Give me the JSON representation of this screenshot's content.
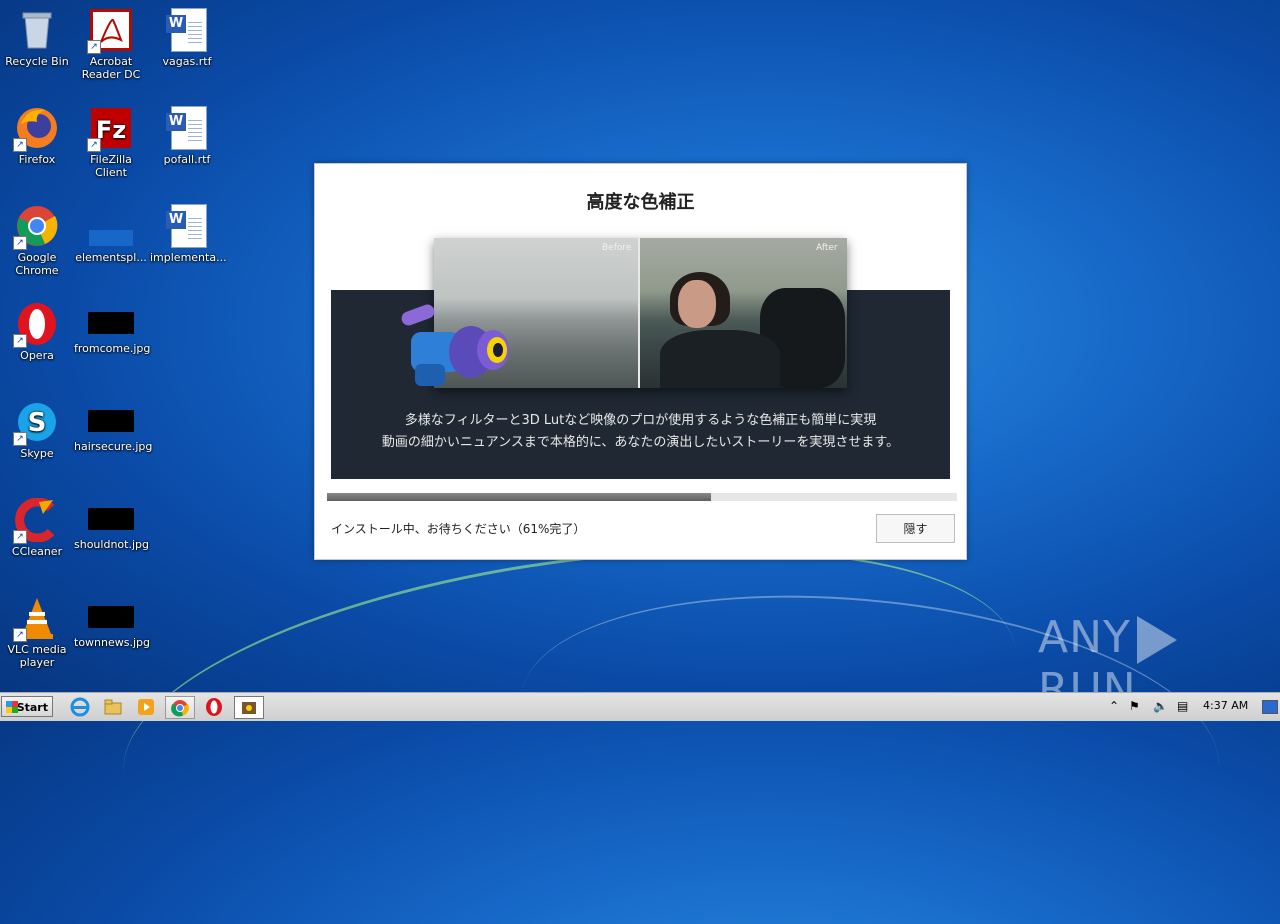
{
  "desktop": {
    "icons": [
      {
        "label": "Recycle Bin",
        "icon": "recycle-bin-icon"
      },
      {
        "label": "Acrobat Reader DC",
        "icon": "acrobat-icon"
      },
      {
        "label": "vagas.rtf",
        "icon": "word-doc-icon"
      },
      {
        "label": "Firefox",
        "icon": "firefox-icon"
      },
      {
        "label": "FileZilla Client",
        "icon": "filezilla-icon"
      },
      {
        "label": "pofall.rtf",
        "icon": "word-doc-icon"
      },
      {
        "label": "Google Chrome",
        "icon": "chrome-icon"
      },
      {
        "label": "elementspl...",
        "icon": "blank-file-icon"
      },
      {
        "label": "implementa...",
        "icon": "word-doc-icon"
      },
      {
        "label": "Opera",
        "icon": "opera-icon"
      },
      {
        "label": "fromcome.jpg",
        "icon": "jpg-thumb-icon"
      },
      {
        "label": "Skype",
        "icon": "skype-icon"
      },
      {
        "label": "hairsecure.jpg",
        "icon": "jpg-thumb-icon"
      },
      {
        "label": "CCleaner",
        "icon": "ccleaner-icon"
      },
      {
        "label": "shouldnot.jpg",
        "icon": "jpg-thumb-icon"
      },
      {
        "label": "VLC media player",
        "icon": "vlc-icon"
      },
      {
        "label": "townnews.jpg",
        "icon": "jpg-thumb-icon"
      }
    ]
  },
  "installer": {
    "title": "高度な色補正",
    "before_label": "Before",
    "after_label": "After",
    "line1": "多様なフィルターと3D Lutなど映像のプロが使用するような色補正も簡単に実現",
    "line2": "動画の細かいニュアンスまで本格的に、あなたの演出したいストーリーを実現させます。",
    "progress_percent": 61,
    "status": "インストール中、お待ちください（61%完了）",
    "hide_button": "隠す"
  },
  "taskbar": {
    "start_label": "Start",
    "clock": "4:37 AM"
  },
  "watermark": {
    "left": "ANY",
    "right": "RUN"
  },
  "colors": {
    "banner_bg": "#1f2833",
    "progress_fill": "#6e6e6e",
    "desktop_blue": "#1667c7"
  }
}
